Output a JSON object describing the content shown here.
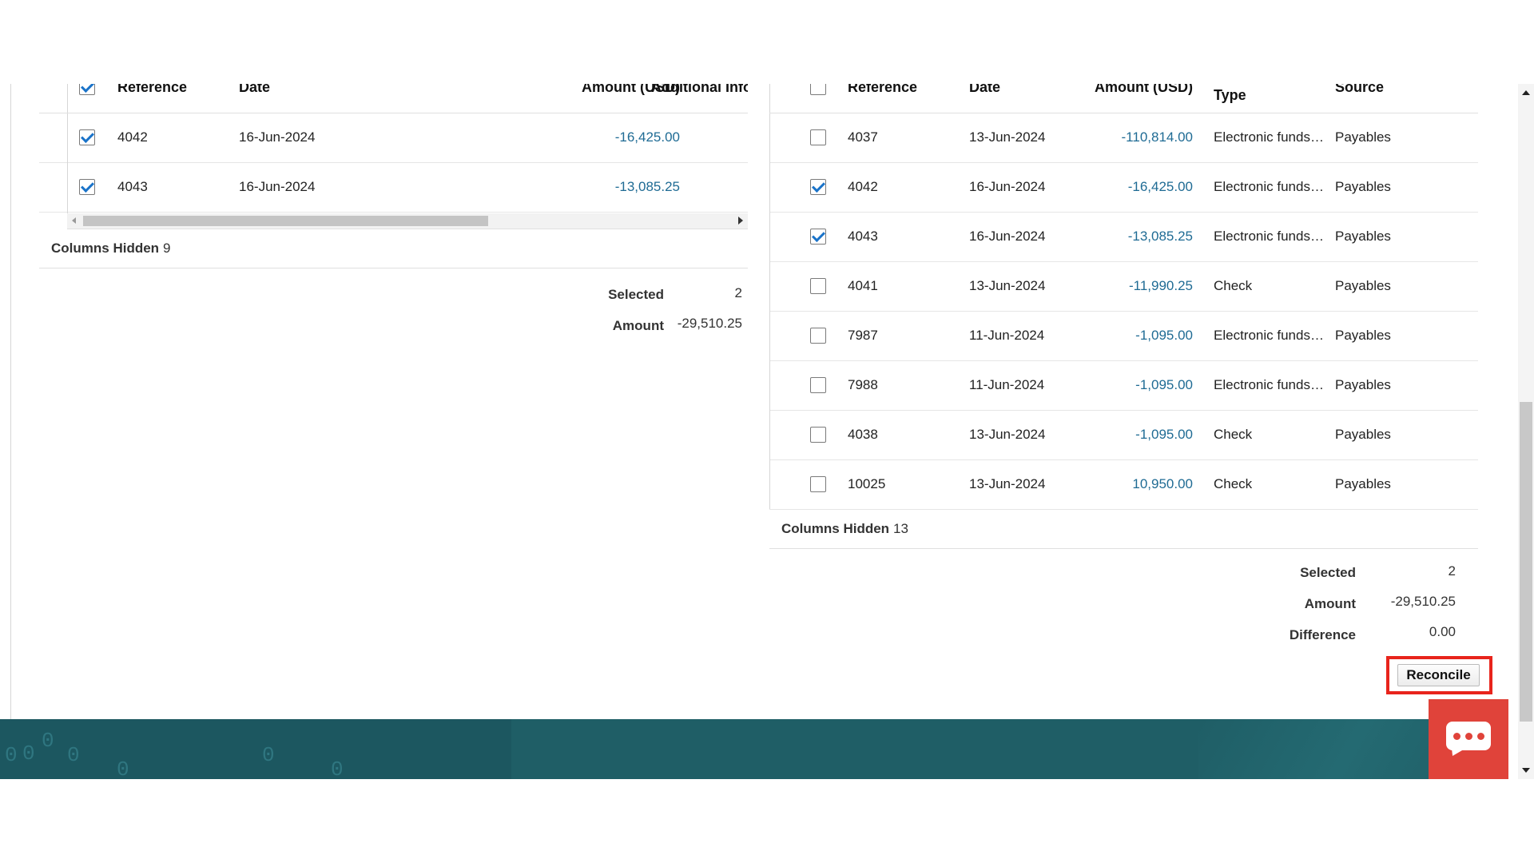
{
  "left_table": {
    "headers": {
      "reference": "Reference",
      "date": "Date",
      "amount": "Amount (USD)",
      "additional": "Additional Info"
    },
    "header_checked": true,
    "rows": [
      {
        "checked": true,
        "reference": "4042",
        "date": "16-Jun-2024",
        "amount": "-16,425.00"
      },
      {
        "checked": true,
        "reference": "4043",
        "date": "16-Jun-2024",
        "amount": "-13,085.25"
      }
    ],
    "columns_hidden_label": "Columns Hidden",
    "columns_hidden_count": "9",
    "summary": {
      "selected_label": "Selected",
      "selected_value": "2",
      "amount_label": "Amount",
      "amount_value": "-29,510.25"
    }
  },
  "right_table": {
    "headers": {
      "reference": "Reference",
      "date": "Date",
      "amount": "Amount (USD)",
      "type": "Type",
      "source": "Source"
    },
    "header_checked": false,
    "rows": [
      {
        "checked": false,
        "reference": "4037",
        "date": "13-Jun-2024",
        "amount": "-110,814.00",
        "type": "Electronic funds…",
        "source": "Payables"
      },
      {
        "checked": true,
        "reference": "4042",
        "date": "16-Jun-2024",
        "amount": "-16,425.00",
        "type": "Electronic funds…",
        "source": "Payables"
      },
      {
        "checked": true,
        "reference": "4043",
        "date": "16-Jun-2024",
        "amount": "-13,085.25",
        "type": "Electronic funds…",
        "source": "Payables"
      },
      {
        "checked": false,
        "reference": "4041",
        "date": "13-Jun-2024",
        "amount": "-11,990.25",
        "type": "Check",
        "source": "Payables"
      },
      {
        "checked": false,
        "reference": "7987",
        "date": "11-Jun-2024",
        "amount": "-1,095.00",
        "type": "Electronic funds…",
        "source": "Payables"
      },
      {
        "checked": false,
        "reference": "7988",
        "date": "11-Jun-2024",
        "amount": "-1,095.00",
        "type": "Electronic funds…",
        "source": "Payables"
      },
      {
        "checked": false,
        "reference": "4038",
        "date": "13-Jun-2024",
        "amount": "-1,095.00",
        "type": "Check",
        "source": "Payables"
      },
      {
        "checked": false,
        "reference": "10025",
        "date": "13-Jun-2024",
        "amount": "10,950.00",
        "type": "Check",
        "source": "Payables"
      }
    ],
    "columns_hidden_label": "Columns Hidden",
    "columns_hidden_count": "13",
    "summary": {
      "selected_label": "Selected",
      "selected_value": "2",
      "amount_label": "Amount",
      "amount_value": "-29,510.25",
      "difference_label": "Difference",
      "difference_value": "0.00"
    }
  },
  "actions": {
    "reconcile_label": "Reconcile"
  },
  "chat": {
    "icon": "chat-icon"
  },
  "colors": {
    "link_amount": "#1f6b94",
    "checkbox_check": "#1a73c9",
    "highlight": "#e8241c",
    "footer": "#1f5e66",
    "chat_bg": "#e0433a"
  }
}
